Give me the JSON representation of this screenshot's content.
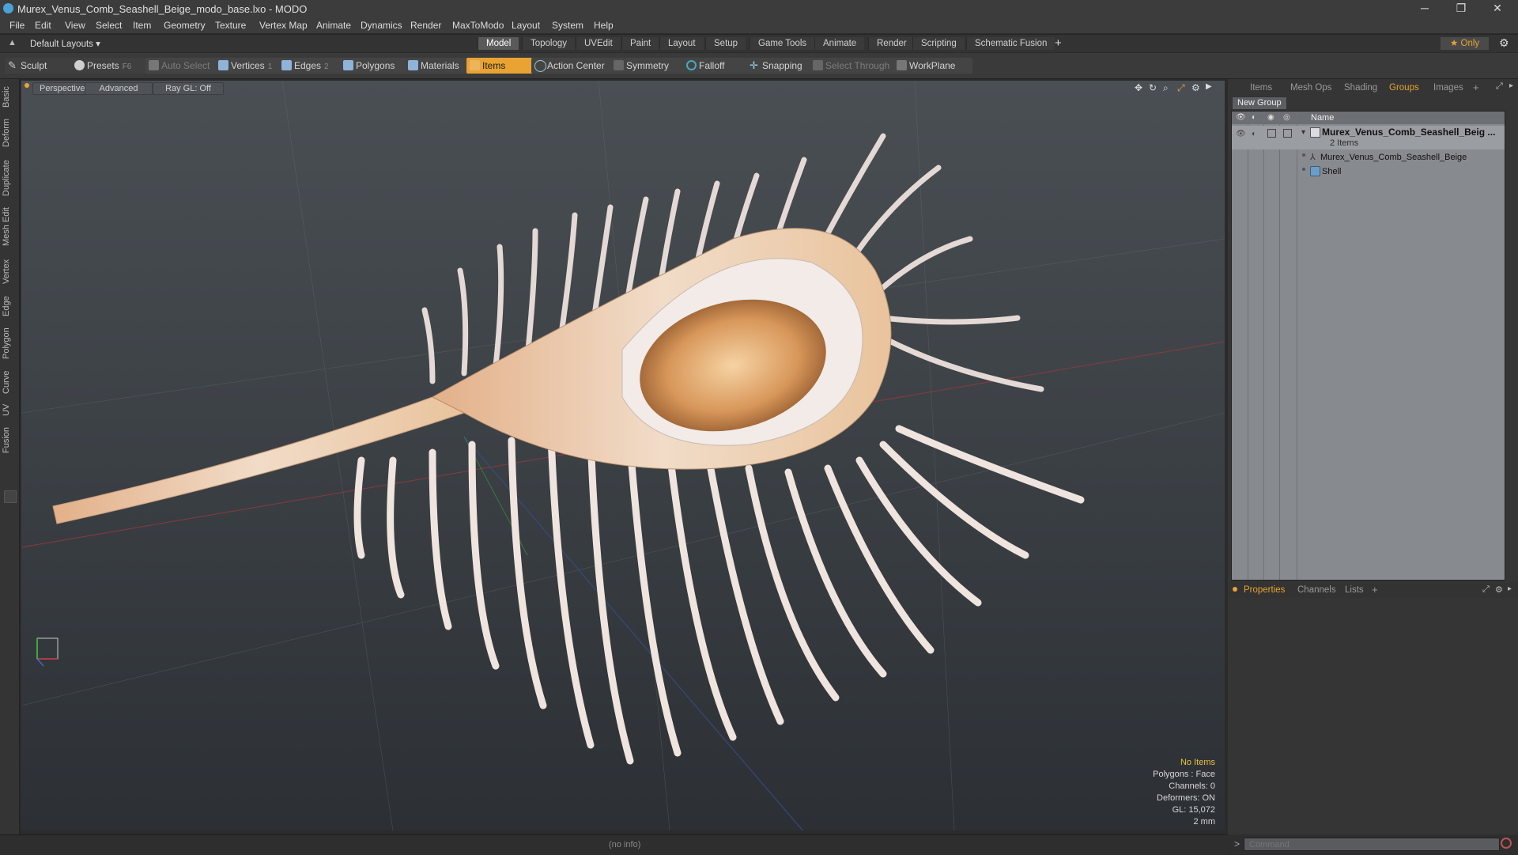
{
  "window": {
    "title": "Murex_Venus_Comb_Seashell_Beige_modo_base.lxo - MODO",
    "minimize": "─",
    "restore": "❐",
    "close": "✕"
  },
  "menu": [
    "File",
    "Edit",
    "View",
    "Select",
    "Item",
    "Geometry",
    "Texture",
    "Vertex Map",
    "Animate",
    "Dynamics",
    "Render",
    "MaxToModo",
    "Layout",
    "System",
    "Help"
  ],
  "layout_selector": "Default Layouts ▾",
  "layout_tabs": [
    "Model",
    "Topology",
    "UVEdit",
    "Paint",
    "Layout",
    "Setup",
    "Game Tools",
    "Animate",
    "Render",
    "Scripting",
    "Schematic Fusion"
  ],
  "layout_tab_add": "+",
  "only_label": "★ Only",
  "toolbar": {
    "sculpt": "Sculpt",
    "presets": "Presets",
    "presets_shortcut": "F6",
    "auto_select": "Auto Select",
    "vertices": "Vertices",
    "vertices_count": "1",
    "edges": "Edges",
    "edges_count": "2",
    "polygons": "Polygons",
    "materials": "Materials",
    "items": "Items",
    "action_center": "Action Center",
    "symmetry": "Symmetry",
    "falloff": "Falloff",
    "snapping": "Snapping",
    "select_through": "Select Through",
    "workplane": "WorkPlane"
  },
  "left_tabs": [
    "Basic",
    "Deform",
    "Duplicate",
    "Mesh Edit",
    "Vertex",
    "Edge",
    "Polygon",
    "Curve",
    "UV",
    "Fusion"
  ],
  "viewport": {
    "perspective": "Perspective",
    "advanced": "Advanced",
    "raygl": "Ray GL: Off",
    "info": {
      "no_items": "No Items",
      "polygons": "Polygons : Face",
      "channels": "Channels: 0",
      "deformers": "Deformers: ON",
      "gl": "GL: 15,072",
      "scale": "2 mm"
    }
  },
  "right_tabs": [
    "Items",
    "Mesh Ops",
    "Shading",
    "Groups",
    "Images"
  ],
  "right_tab_add": "+",
  "groups": {
    "new_group": "New Group",
    "name_header": "Name",
    "group_name": "Murex_Venus_Comb_Seashell_Beig ...",
    "group_count": "2 Items",
    "children": [
      "Murex_Venus_Comb_Seashell_Beige",
      "Shell"
    ]
  },
  "props_tabs": [
    "Properties",
    "Channels",
    "Lists"
  ],
  "props_tab_add": "+",
  "status": {
    "info": "(no info)",
    "command_prompt": ">",
    "command_placeholder": "Command"
  },
  "colors": {
    "accent": "#e8a333",
    "items_highlight": "#e8a333"
  }
}
